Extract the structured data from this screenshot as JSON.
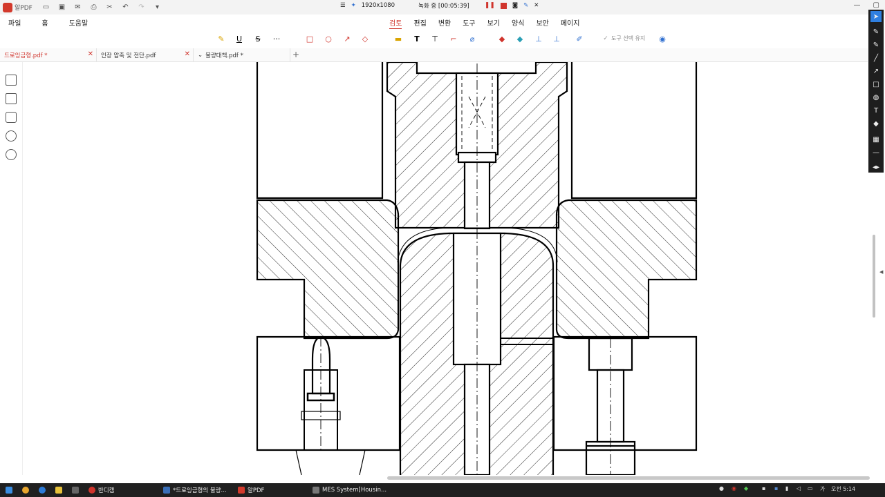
{
  "app": {
    "logo_text": "알PDF"
  },
  "recording": {
    "resolution": "1920x1080",
    "status": "녹화 중 [00:05:39]"
  },
  "menu": {
    "left": [
      "파일",
      "홈",
      "도움말"
    ],
    "tabs": [
      "검토",
      "편집",
      "변환",
      "도구",
      "보기",
      "양식",
      "보안",
      "페이지"
    ],
    "active_tab": "검토"
  },
  "toolbar": {
    "keep_tool_label": "도구 선택 유지"
  },
  "tabs": [
    {
      "label": "드로잉금형.pdf *"
    },
    {
      "label": "인장 압축 및 전단.pdf"
    },
    {
      "label": "불량대책.pdf *"
    }
  ],
  "taskbar": {
    "items": [
      "반디캠",
      "*드로잉금형의 불량...",
      "알PDF",
      "MES System[Housin..."
    ],
    "ime": "가",
    "clock": "오전 5:14"
  },
  "colors": {
    "accent": "#d0342c",
    "selected_tool": "#2f7fe0"
  }
}
